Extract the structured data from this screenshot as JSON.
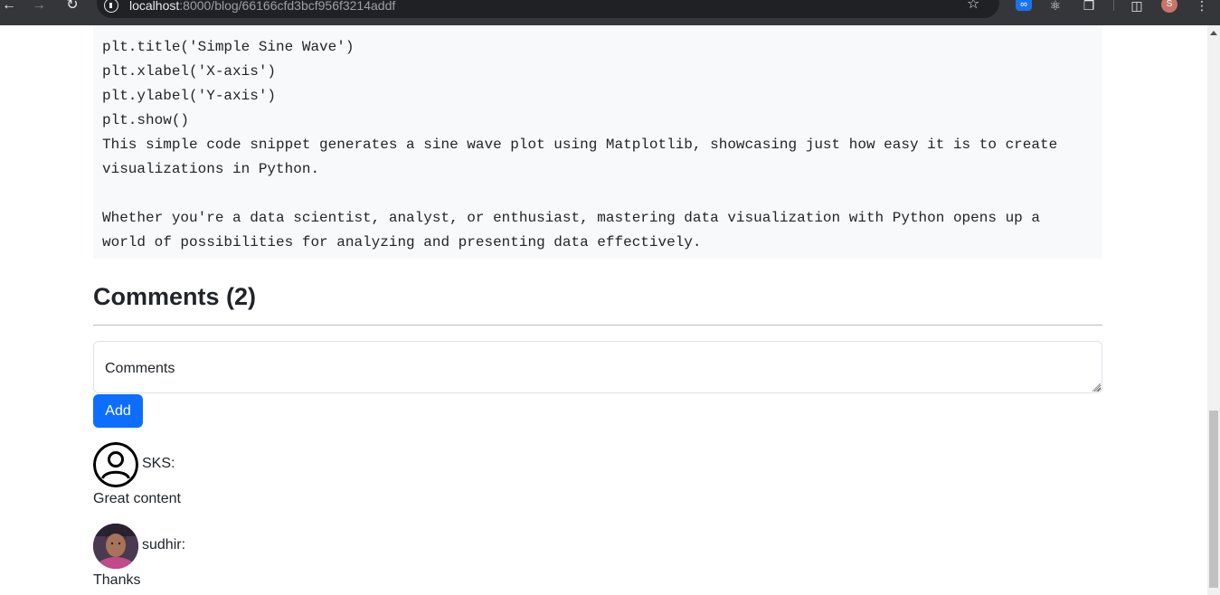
{
  "browser": {
    "back_icon": "back-arrow-icon",
    "forward_icon": "forward-arrow-icon",
    "reload_icon": "reload-icon",
    "url_host": "localhost",
    "url_rest": ":8000/blog/66166cfd3bcf956f3214addf",
    "bookmark_icon": "star-icon",
    "extensions": [
      "infinity-extension-icon",
      "react-devtools-icon",
      "puzzle-extensions-icon"
    ],
    "side_panel_icon": "side-panel-icon",
    "profile_initial": "S",
    "menu_icon": "kebab-menu-icon"
  },
  "post": {
    "code_lines": [
      "plt.title('Simple Sine Wave')",
      "plt.xlabel('X-axis')",
      "plt.ylabel('Y-axis')",
      "plt.show()",
      "This simple code snippet generates a sine wave plot using Matplotlib, showcasing just how easy it is to create",
      "visualizations in Python.",
      "Whether you're a data scientist, analyst, or enthusiast, mastering data visualization with Python opens up a",
      "world of possibilities for analyzing and presenting data effectively."
    ]
  },
  "comments": {
    "heading": "Comments (2)",
    "input_placeholder": "Comments",
    "add_label": "Add",
    "items": [
      {
        "user": "SKS:",
        "text": "Great content",
        "avatar_icon": "default-user-icon"
      },
      {
        "user": "sudhir:",
        "text": "Thanks",
        "avatar_icon": "user-photo"
      }
    ]
  },
  "colors": {
    "accent": "#0d6efd",
    "code_background": "#f8f9fa",
    "browser_chrome": "#35363a"
  }
}
